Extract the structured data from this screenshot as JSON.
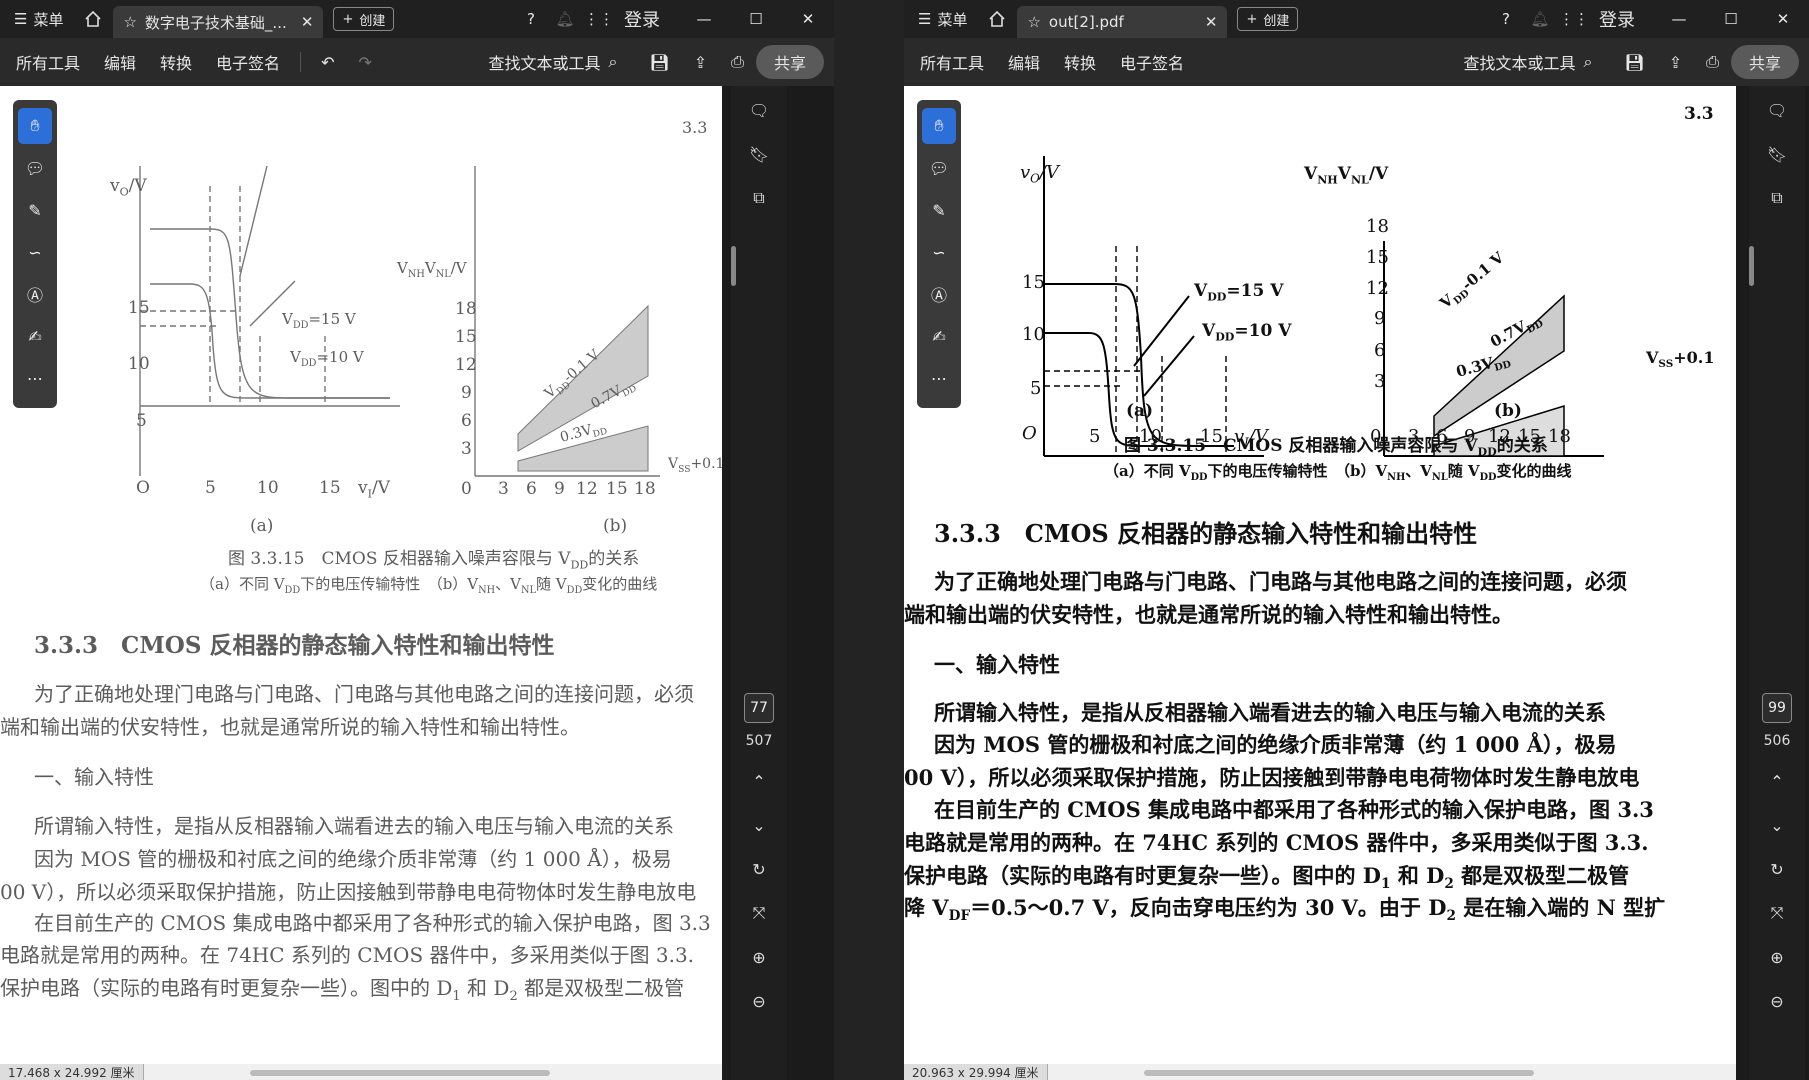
{
  "left": {
    "menu_label": "菜单",
    "tab_title": "数字电子技术基础_...",
    "create_label": "创建",
    "login": "登录",
    "toolbar": {
      "all_tools": "所有工具",
      "edit": "编辑",
      "convert": "转换",
      "esign": "电子签名",
      "find": "查找文本或工具",
      "share": "共享"
    },
    "page_current": "77",
    "page_total": "507",
    "status_size": "17.468 x 24.992 厘米",
    "doc": {
      "header_no": "3.3",
      "vo_axis": "v",
      "vo_sub": "O",
      "vo_unit": "/V",
      "vi_axis": "v",
      "vi_sub": "I",
      "vi_unit": "/V",
      "nh_axis": "V",
      "nh_sub": "NH",
      "nl_sub": "NL",
      "nl_unit": "/V",
      "vdd15": "=15 V",
      "vdd10": "=10 V",
      "vdd": "V",
      "vdd_sub": "DD",
      "ay": [
        "15",
        "10",
        "5"
      ],
      "ax": [
        "O",
        "5",
        "10",
        "15"
      ],
      "by": [
        "18",
        "15",
        "12",
        "9",
        "6",
        "3"
      ],
      "bx": [
        "0",
        "3",
        "6",
        "9",
        "12",
        "15",
        "18"
      ],
      "line1": "V",
      "line1_sub": "DD",
      "line1_tail": "-0.1 V",
      "line2": "0.7V",
      "line2_sub": "DD",
      "line3": "0.3V",
      "line3_sub": "DD",
      "vss": "V",
      "vss_sub": "SS",
      "vss_tail": "+0.1",
      "a": "(a)",
      "b": "(b)",
      "caption": "图 3.3.15　CMOS 反相器输入噪声容限与 V",
      "caption_sub": "DD",
      "caption_tail": "的关系",
      "subcap_a": "（a）不同 V",
      "subcap_a_sub": "DD",
      "subcap_a_tail": "下的电压传输特性　（b）V",
      "subcap_b_sub1": "NH",
      "subcap_b_mid": "、V",
      "subcap_b_sub2": "NL",
      "subcap_b_mid2": "随 V",
      "subcap_b_sub3": "DD",
      "subcap_b_tail": "变化的曲线",
      "section": "3.3.3　CMOS 反相器的静态输入特性和输出特性",
      "p1": "为了正确地处理门电路与门电路、门电路与其他电路之间的连接问题，必须",
      "p2": "端和输出端的伏安特性，也就是通常所说的输入特性和输出特性。",
      "h1": "一、输入特性",
      "p3": "所谓输入特性，是指从反相器输入端看进去的输入电压与输入电流的关系",
      "p4": "因为 MOS 管的栅极和衬底之间的绝缘介质非常薄（约 1 000 Å），极易",
      "p5": "00 V），所以必须采取保护措施，防止因接触到带静电电荷物体时发生静电放电",
      "p6": "在目前生产的 CMOS 集成电路中都采用了各种形式的输入保护电路，图 3.3",
      "p7": "电路就是常用的两种。在 74HC 系列的 CMOS 器件中，多采用类似于图 3.3.",
      "p8": "保护电路（实际的电路有时更复杂一些）。图中的 D",
      "p8_sub1": "1",
      "p8_mid": " 和 D",
      "p8_sub2": "2",
      "p8_tail": " 都是双极型二极管"
    }
  },
  "right": {
    "menu_label": "菜单",
    "tab_title": "out[2].pdf",
    "create_label": "创建",
    "login": "登录",
    "toolbar": {
      "all_tools": "所有工具",
      "edit": "编辑",
      "convert": "转换",
      "esign": "电子签名",
      "find": "查找文本或工具",
      "share": "共享"
    },
    "page_current": "99",
    "page_total": "506",
    "status_size": "20.963 x 29.994 厘米",
    "doc": {
      "p9": "降 V",
      "p9_sub": "DF",
      "p9_tail": "＝0.5～0.7 V，反向击穿电压约为 30 V。由于 D",
      "p9_sub2": "2",
      "p9_tail2": " 是在输入端的 N 型扩"
    }
  },
  "colors": {
    "accent": "#2d6fd8",
    "chrome": "#202020",
    "toolbar": "#2a2a2a"
  }
}
